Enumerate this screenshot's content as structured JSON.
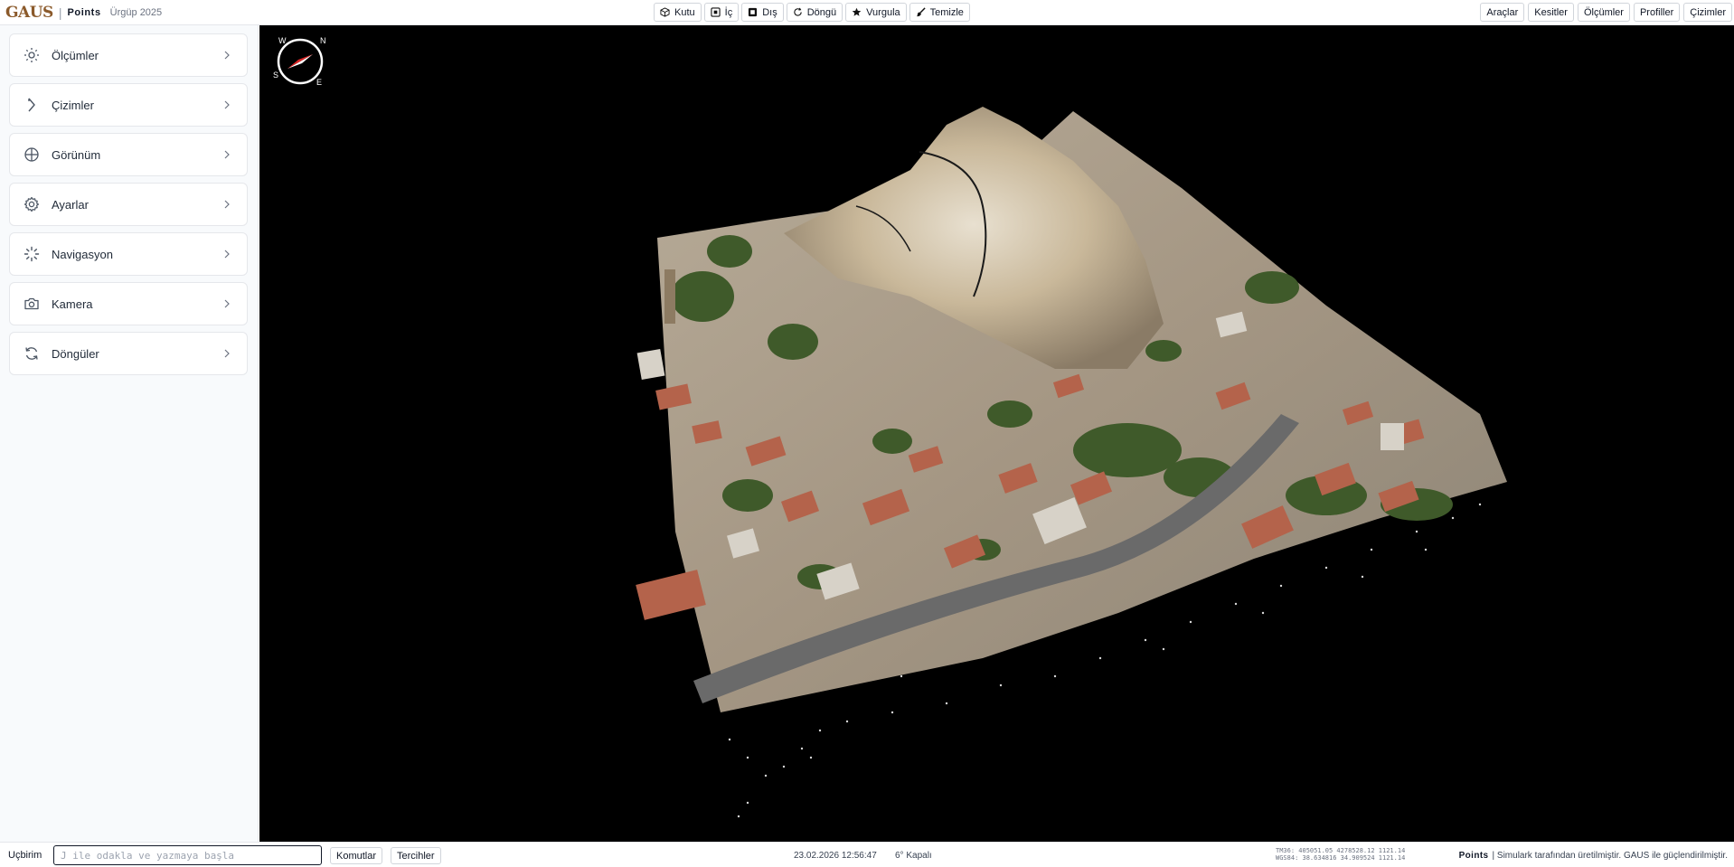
{
  "brand": {
    "logo": "GAUS",
    "separator": "|",
    "product": "Points",
    "project": "Ürgüp 2025"
  },
  "toolbar": [
    {
      "label": "Kutu",
      "icon": "box-icon"
    },
    {
      "label": "İç",
      "icon": "inside-icon"
    },
    {
      "label": "Dış",
      "icon": "outside-icon"
    },
    {
      "label": "Döngü",
      "icon": "loop-icon"
    },
    {
      "label": "Vurgula",
      "icon": "star-icon"
    },
    {
      "label": "Temizle",
      "icon": "brush-icon"
    }
  ],
  "menu": [
    {
      "label": "Araçlar"
    },
    {
      "label": "Kesitler"
    },
    {
      "label": "Ölçümler"
    },
    {
      "label": "Profiller"
    },
    {
      "label": "Çizimler"
    }
  ],
  "sidebar": {
    "panels": [
      {
        "label": "Ölçümler",
        "icon": "sun-icon"
      },
      {
        "label": "Çizimler",
        "icon": "tag-icon"
      },
      {
        "label": "Görünüm",
        "icon": "globe-icon"
      },
      {
        "label": "Ayarlar",
        "icon": "gear-icon"
      },
      {
        "label": "Navigasyon",
        "icon": "loader-icon"
      },
      {
        "label": "Kamera",
        "icon": "camera-icon"
      },
      {
        "label": "Döngüler",
        "icon": "refresh-icon"
      }
    ]
  },
  "viewport": {
    "compass_letters": [
      "N",
      "E",
      "S",
      "W"
    ],
    "background": "#000000"
  },
  "statusbar": {
    "terminal_label": "Uçbirim",
    "terminal_placeholder": "J ile odakla ve yazmaya başla",
    "commands_label": "Komutlar",
    "preferences_label": "Tercihler",
    "datetime": "23.02.2026 12:56:47",
    "weather": "6° Kapalı",
    "coords_tm": "TM36: 405051.05 4278528.12 1121.14",
    "coords_wgs": "WGS84: 38.634816 34.909524 1121.14",
    "credit_product": "Points",
    "credit_text": "| Simulark tarafından üretilmiştir. GAUS ile güçlendirilmiştir."
  },
  "colors": {
    "brand": "#8b5a2b",
    "compass_needle": "#dc2626"
  }
}
